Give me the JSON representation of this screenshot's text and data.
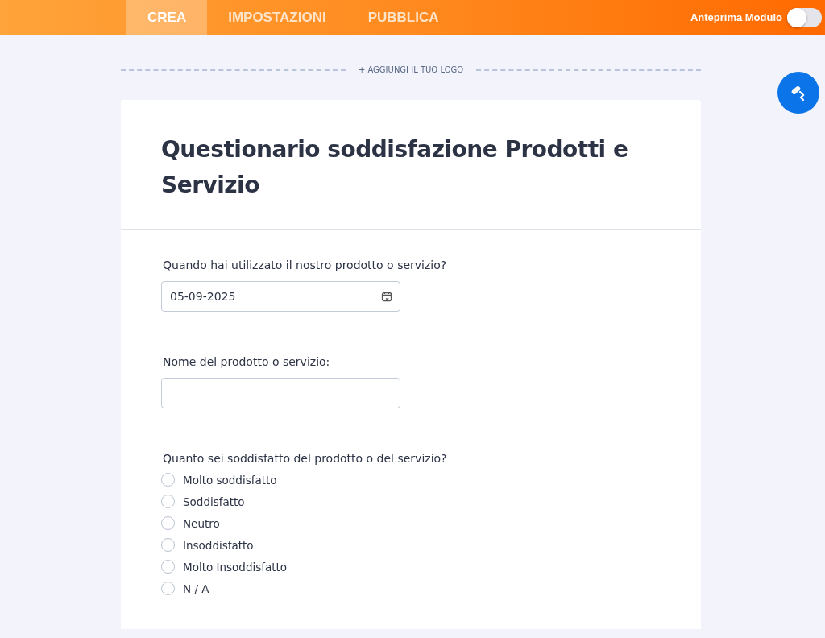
{
  "tabs": [
    {
      "label": "CREA",
      "selected": true
    },
    {
      "label": "IMPOSTAZIONI",
      "selected": false
    },
    {
      "label": "PUBBLICA",
      "selected": false
    }
  ],
  "preview": {
    "label": "Anteprima Modulo",
    "on": false
  },
  "logo_link": "+ AGGIUNGI IL TUO LOGO",
  "form": {
    "title": "Questionario soddisfazione Prodotti e Servizio",
    "fields": [
      {
        "kind": "date",
        "label": "Quando hai utilizzato il nostro prodotto o servizio?",
        "value": "05-09-2025"
      },
      {
        "kind": "text",
        "label": "Nome del prodotto o servizio:"
      },
      {
        "kind": "radio",
        "label": "Quanto sei soddisfatto del prodotto o del servizio?",
        "options": [
          {
            "label": "Molto soddisfatto",
            "selected": false
          },
          {
            "label": "Soddisfatto",
            "selected": false
          },
          {
            "label": "Neutro",
            "selected": false
          },
          {
            "label": "Insoddisfatto",
            "selected": false
          },
          {
            "label": "Molto Insoddisfatto",
            "selected": false
          },
          {
            "label": "N / A",
            "selected": false
          }
        ]
      }
    ]
  }
}
